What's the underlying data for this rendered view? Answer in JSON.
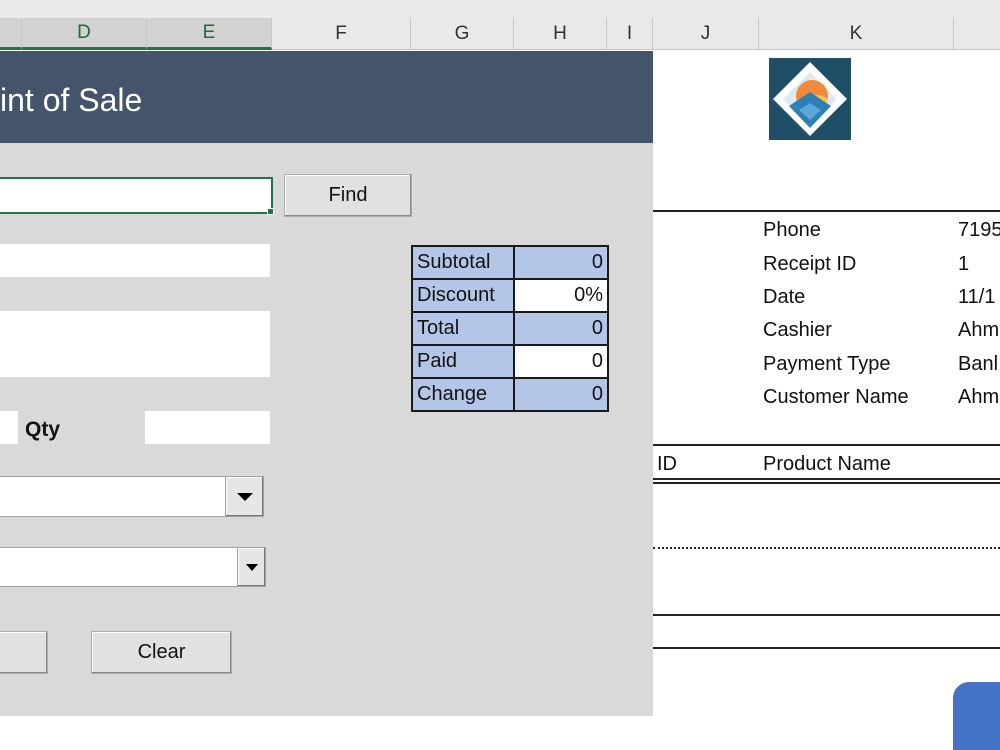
{
  "columns": [
    "D",
    "E",
    "F",
    "G",
    "H",
    "I",
    "J",
    "K"
  ],
  "form": {
    "title": "int of Sale",
    "find_label": "Find",
    "qty_label": "Qty",
    "clear_label": "Clear"
  },
  "totals": [
    {
      "label": "Subtotal",
      "value": "0"
    },
    {
      "label": "Discount",
      "value": "0%"
    },
    {
      "label": "Total",
      "value": "0"
    },
    {
      "label": "Paid",
      "value": "0"
    },
    {
      "label": "Change",
      "value": "0"
    }
  ],
  "receipt": {
    "fields": [
      {
        "label": "Phone",
        "value": "7195"
      },
      {
        "label": "Receipt ID",
        "value": "1"
      },
      {
        "label": "Date",
        "value": "11/1"
      },
      {
        "label": "Cashier",
        "value": "Ahm"
      },
      {
        "label": "Payment Type",
        "value": "Banl"
      },
      {
        "label": "Customer Name",
        "value": "Ahm"
      }
    ],
    "col_id": "ID",
    "col_product": "Product Name"
  },
  "colors": {
    "banner": "#44546a",
    "form_bg": "#d9d9d9",
    "totals_fill": "#b4c6e7",
    "accent_green": "#217346",
    "blue_button": "#4472c4"
  }
}
